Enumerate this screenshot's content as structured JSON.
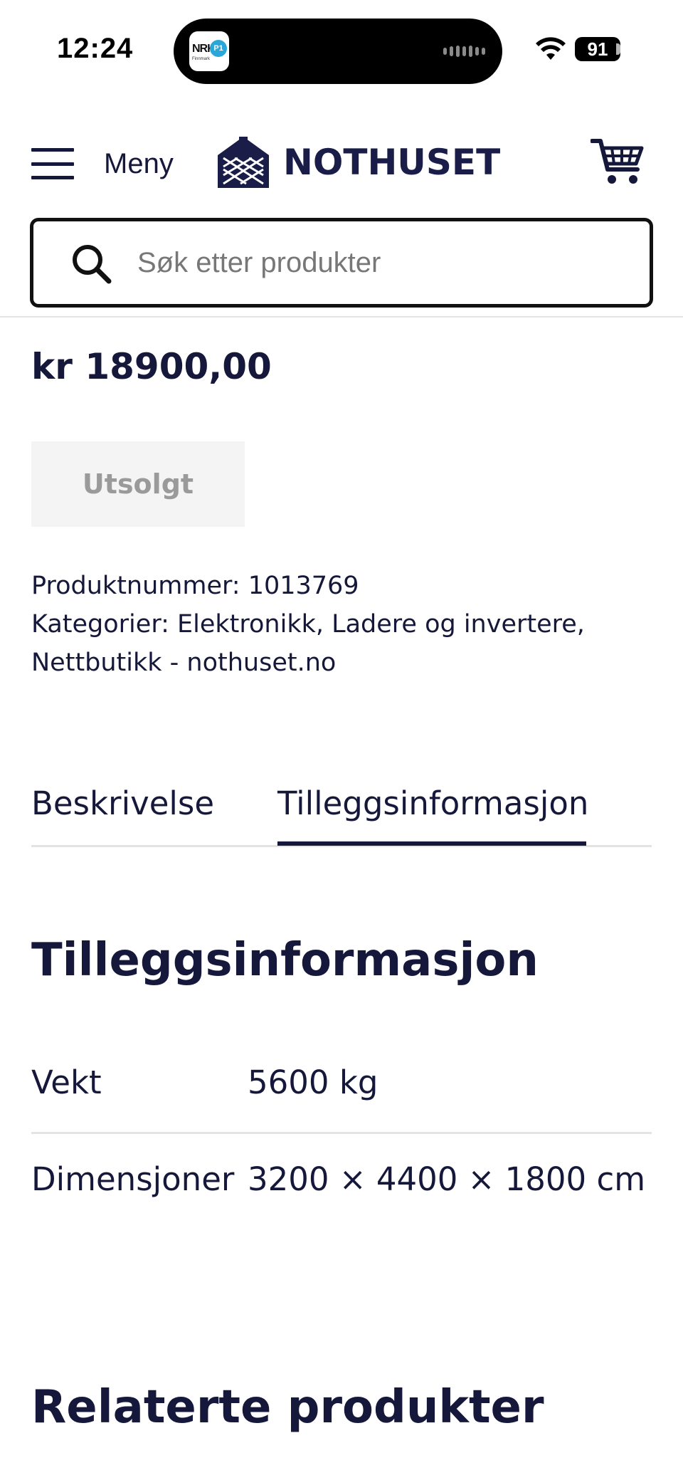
{
  "status_bar": {
    "time": "12:24",
    "battery": "91",
    "live_activity_app": "NRK P1",
    "live_activity_app_small": "NRK",
    "live_activity_app_badge": "P1",
    "live_activity_app_sub": "Finnmark"
  },
  "header": {
    "menu_label": "Meny",
    "logo_text": "NOTHUSET",
    "cart_icon": "cart-icon"
  },
  "search": {
    "placeholder": "Søk etter produkter",
    "value": ""
  },
  "product": {
    "price": "kr 18900,00",
    "stock_button": "Utsolgt",
    "sku_line": "Produktnummer: 1013769",
    "categories_line1": "Kategorier: Elektronikk, Ladere og invertere,",
    "categories_line2": "Nettbutikk - nothuset.no"
  },
  "tabs": [
    {
      "label": "Beskrivelse",
      "active": false
    },
    {
      "label": "Tilleggsinformasjon",
      "active": true
    }
  ],
  "additional_info": {
    "title": "Tilleggsinformasjon",
    "rows": [
      {
        "label": "Vekt",
        "value": "5600 kg"
      },
      {
        "label": "Dimensjoner",
        "value": "3200 × 4400 × 1800 cm"
      }
    ]
  },
  "related": {
    "title": "Relaterte produkter"
  },
  "colors": {
    "brand_navy": "#15183a",
    "soldout_bg": "#f4f4f4",
    "soldout_text": "#9a9a9a",
    "divider": "#e3e3e3"
  }
}
